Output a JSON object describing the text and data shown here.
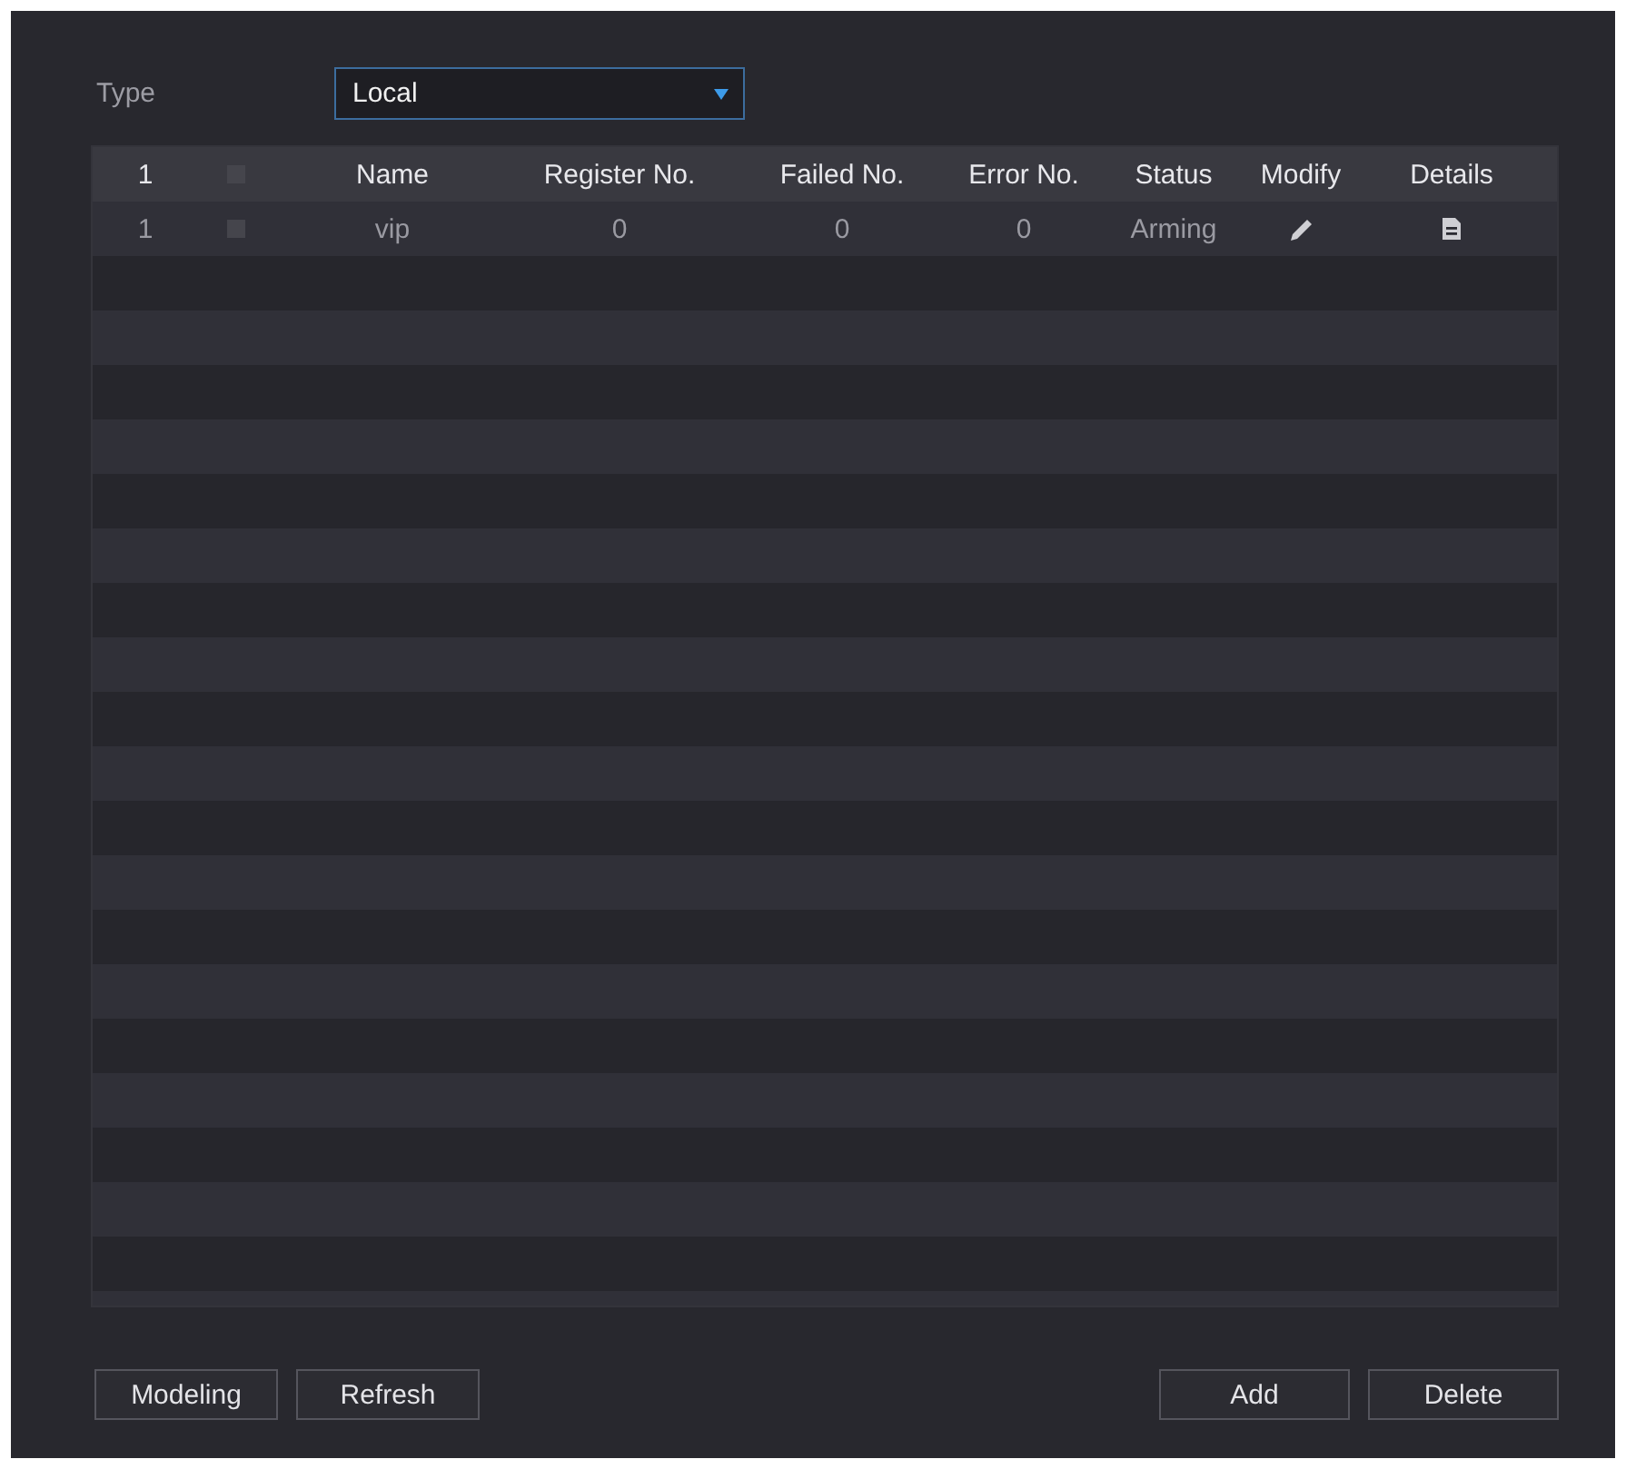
{
  "type_field": {
    "label": "Type",
    "value": "Local"
  },
  "table": {
    "columns": [
      {
        "kind": "text",
        "label": "1"
      },
      {
        "kind": "checkbox",
        "checked": false
      },
      {
        "kind": "text",
        "label": "Name"
      },
      {
        "kind": "text",
        "label": "Register No."
      },
      {
        "kind": "text",
        "label": "Failed No."
      },
      {
        "kind": "text",
        "label": "Error No."
      },
      {
        "kind": "text",
        "label": "Status"
      },
      {
        "kind": "text",
        "label": "Modify"
      },
      {
        "kind": "text",
        "label": "Details"
      }
    ],
    "rows": [
      {
        "cells": [
          {
            "kind": "text",
            "value": "1"
          },
          {
            "kind": "checkbox",
            "checked": false
          },
          {
            "kind": "text",
            "value": "vip"
          },
          {
            "kind": "text",
            "value": "0"
          },
          {
            "kind": "text",
            "value": "0"
          },
          {
            "kind": "text",
            "value": "0"
          },
          {
            "kind": "text",
            "value": "Arming"
          },
          {
            "kind": "pencil"
          },
          {
            "kind": "document"
          }
        ]
      }
    ]
  },
  "buttons_left": [
    {
      "label": "Modeling"
    },
    {
      "label": "Refresh"
    }
  ],
  "buttons_right": [
    {
      "label": "Add"
    },
    {
      "label": "Delete"
    }
  ]
}
